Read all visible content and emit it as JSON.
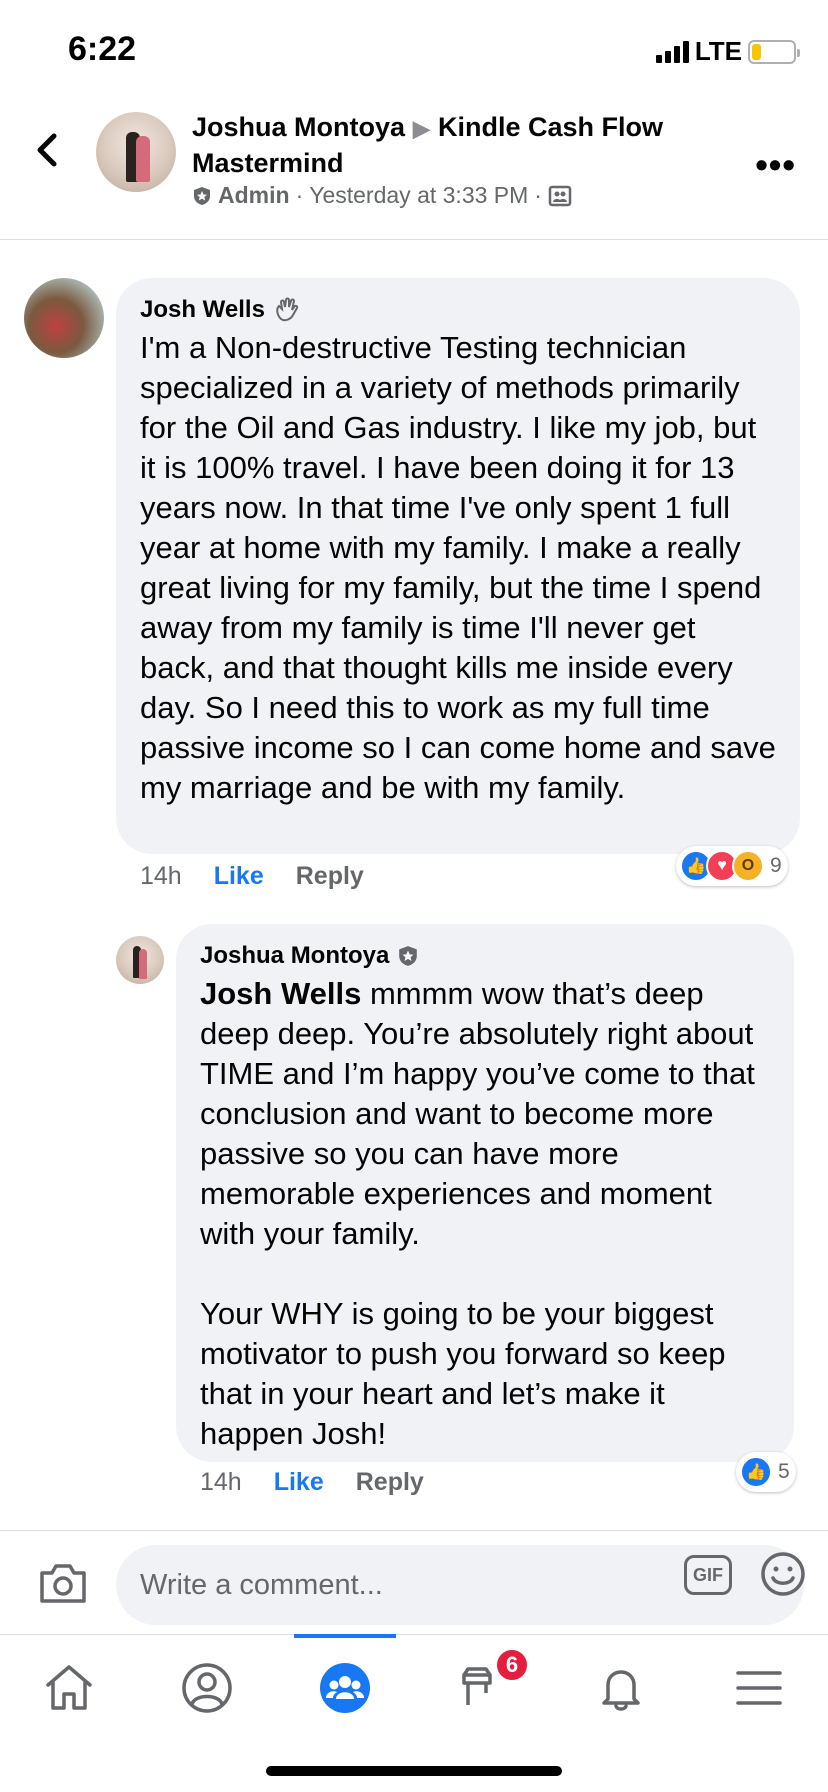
{
  "status_bar": {
    "time": "6:22",
    "network": "LTE"
  },
  "header": {
    "poster": "Joshua Montoya",
    "group": "Kindle Cash Flow Mastermind",
    "role": "Admin",
    "timestamp": "Yesterday at 3:33 PM",
    "separator": "·"
  },
  "comments": [
    {
      "author": "Josh Wells",
      "text": "I'm a Non-destructive Testing technician specialized in a variety of methods primarily for the Oil and Gas industry. I like my job, but it is 100% travel. I have been doing it for 13 years now. In that time I've only spent 1 full year at home with my family. I make a really great living for my family, but the time I spend away from my family is time I'll never get back, and that thought kills me inside every day. So I need this to work as my full time passive income so I can come home and save my marriage and be with my family.",
      "time": "14h",
      "like_label": "Like",
      "reply_label": "Reply",
      "reaction_count": "9",
      "reactions": [
        "like-icon",
        "love-icon",
        "wow-icon"
      ]
    },
    {
      "author": "Joshua Montoya",
      "mention": "Josh Wells",
      "text": " mmmm wow that’s deep deep deep. You’re absolutely right about TIME and I’m happy you’ve come to that conclusion and want to become more passive so you can have more memorable experiences and moment with your family.\n\nYour WHY is going to be your biggest motivator to push you forward so keep that in your heart and let’s make it happen Josh!",
      "time": "14h",
      "like_label": "Like",
      "reply_label": "Reply",
      "reaction_count": "5",
      "reactions": [
        "like-icon"
      ]
    }
  ],
  "composer": {
    "placeholder": "Write a comment...",
    "gif_label": "GIF"
  },
  "bottom_nav": {
    "items": [
      "home-icon",
      "profile-icon",
      "groups-icon",
      "marketplace-icon",
      "notifications-icon",
      "menu-icon"
    ],
    "active": "groups-icon",
    "badge": "6"
  },
  "colors": {
    "accent": "#1877f2",
    "bubble": "#f0f2f5",
    "muted": "#65676b",
    "badge": "#e41e3f"
  }
}
